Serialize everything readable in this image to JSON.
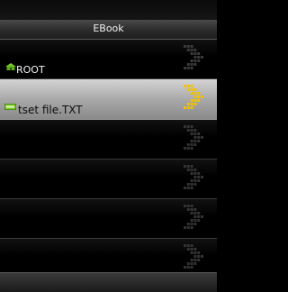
{
  "header": {
    "title": "EBook"
  },
  "list": {
    "items": [
      {
        "label": "ROOT",
        "icon": "home-icon",
        "selected": false
      },
      {
        "label": "tset file.TXT",
        "icon": "text-file-icon",
        "selected": true
      },
      {
        "label": "",
        "icon": "",
        "selected": false
      },
      {
        "label": "",
        "icon": "",
        "selected": false
      },
      {
        "label": "",
        "icon": "",
        "selected": false
      },
      {
        "label": "",
        "icon": "",
        "selected": false
      }
    ]
  },
  "colors": {
    "arrow_active": "#f2c200",
    "arrow_inactive": "#3a3a3a",
    "icon_green": "#7acb2a"
  }
}
